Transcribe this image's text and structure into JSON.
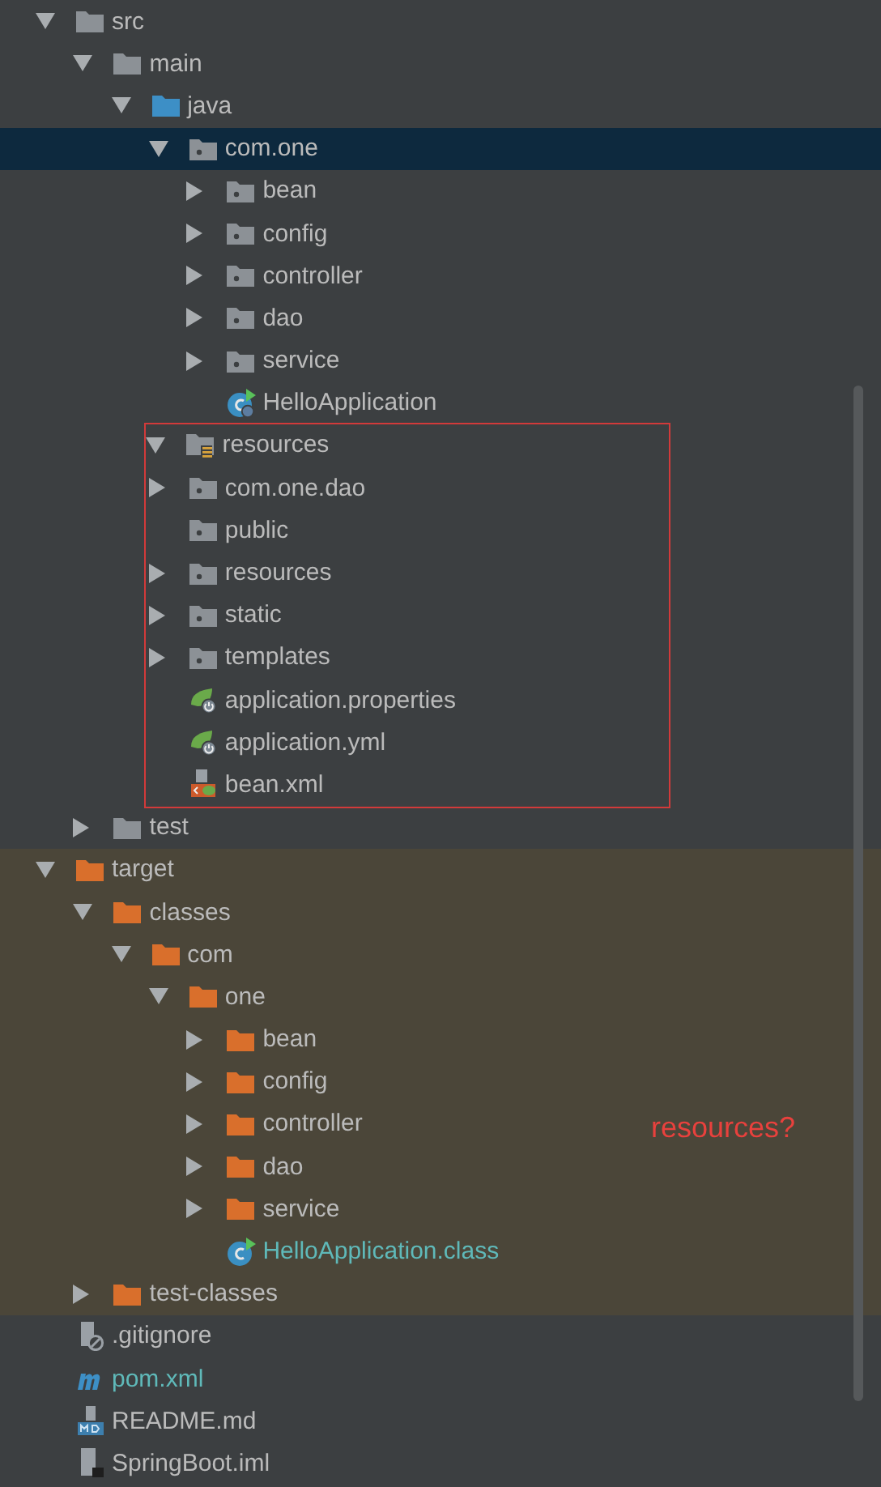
{
  "tree": [
    {
      "label": "src",
      "kind": "folder",
      "expanded": true,
      "children": [
        {
          "label": "main",
          "kind": "folder",
          "expanded": true,
          "children": [
            {
              "label": "java",
              "kind": "source-folder",
              "expanded": true,
              "children": [
                {
                  "label": "com.one",
                  "kind": "package",
                  "expanded": true,
                  "selected": true,
                  "children": [
                    {
                      "label": "bean",
                      "kind": "package",
                      "expanded": false
                    },
                    {
                      "label": "config",
                      "kind": "package",
                      "expanded": false
                    },
                    {
                      "label": "controller",
                      "kind": "package",
                      "expanded": false
                    },
                    {
                      "label": "dao",
                      "kind": "package",
                      "expanded": false
                    },
                    {
                      "label": "service",
                      "kind": "package",
                      "expanded": false
                    },
                    {
                      "label": "HelloApplication",
                      "kind": "spring-class"
                    }
                  ]
                }
              ]
            },
            {
              "label": "resources",
              "kind": "resources-folder",
              "expanded": true,
              "framed": true,
              "children": [
                {
                  "label": "com.one.dao",
                  "kind": "package",
                  "expanded": false
                },
                {
                  "label": "public",
                  "kind": "package"
                },
                {
                  "label": "resources",
                  "kind": "package",
                  "expanded": false
                },
                {
                  "label": "static",
                  "kind": "package",
                  "expanded": false
                },
                {
                  "label": "templates",
                  "kind": "package",
                  "expanded": false
                },
                {
                  "label": "application.properties",
                  "kind": "spring-config"
                },
                {
                  "label": "application.yml",
                  "kind": "spring-config"
                },
                {
                  "label": "bean.xml",
                  "kind": "xml"
                }
              ]
            }
          ]
        },
        {
          "label": "test",
          "kind": "folder",
          "expanded": false
        }
      ]
    },
    {
      "label": "target",
      "kind": "excluded-folder",
      "expanded": true,
      "excluded": true,
      "children": [
        {
          "label": "classes",
          "kind": "excluded-folder",
          "expanded": true,
          "children": [
            {
              "label": "com",
              "kind": "excluded-folder",
              "expanded": true,
              "children": [
                {
                  "label": "one",
                  "kind": "excluded-folder",
                  "expanded": true,
                  "children": [
                    {
                      "label": "bean",
                      "kind": "excluded-folder",
                      "expanded": false
                    },
                    {
                      "label": "config",
                      "kind": "excluded-folder",
                      "expanded": false
                    },
                    {
                      "label": "controller",
                      "kind": "excluded-folder",
                      "expanded": false,
                      "note": "resources?"
                    },
                    {
                      "label": "dao",
                      "kind": "excluded-folder",
                      "expanded": false
                    },
                    {
                      "label": "service",
                      "kind": "excluded-folder",
                      "expanded": false
                    },
                    {
                      "label": "HelloApplication.class",
                      "kind": "class",
                      "color": "#5fb9b9"
                    }
                  ]
                }
              ]
            }
          ]
        },
        {
          "label": "test-classes",
          "kind": "excluded-folder",
          "expanded": false
        }
      ]
    },
    {
      "label": ".gitignore",
      "kind": "ignore-file"
    },
    {
      "label": "pom.xml",
      "kind": "maven",
      "color": "#5fb9b9"
    },
    {
      "label": "README.md",
      "kind": "markdown"
    },
    {
      "label": "SpringBoot.iml",
      "kind": "iml"
    }
  ]
}
